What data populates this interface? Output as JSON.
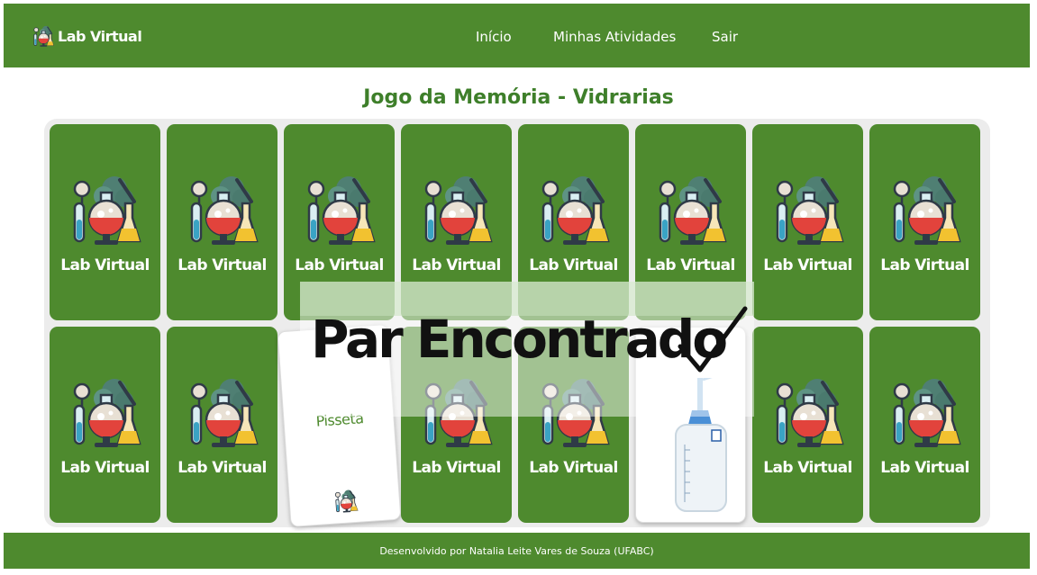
{
  "navbar": {
    "brand_label": "Lab Virtual",
    "links": [
      {
        "label": "Início"
      },
      {
        "label": "Minhas Atividades"
      },
      {
        "label": "Sair"
      }
    ]
  },
  "game": {
    "title": "Jogo da Memória - Vidrarias",
    "card_back_label": "Lab Virtual",
    "revealed_card_name": "Pisseta",
    "match_message": "Par Encontrado",
    "match_icon": "check-icon",
    "card_back_icon": "lab-flask-icon"
  },
  "footer": {
    "text": "Desenvolvido por Natalia Leite Vares de Souza (UFABC)"
  },
  "colors": {
    "primary_green": "#4e8a2e",
    "title_green": "#3e7f2a",
    "board_bg": "#ececec"
  }
}
